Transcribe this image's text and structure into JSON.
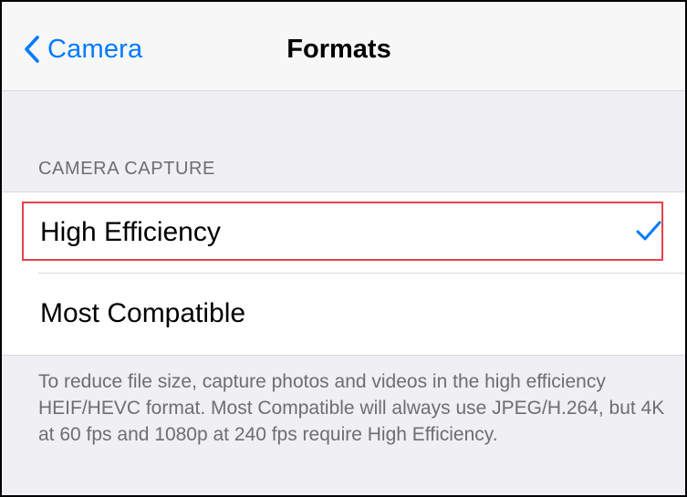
{
  "navbar": {
    "back_label": "Camera",
    "title": "Formats",
    "back_icon": "chevron-left-icon"
  },
  "section": {
    "header": "CAMERA CAPTURE",
    "options": [
      {
        "label": "High Efficiency",
        "selected": true
      },
      {
        "label": "Most Compatible",
        "selected": false
      }
    ],
    "selected_icon": "checkmark-icon",
    "footer": "To reduce file size, capture photos and videos in the high efficiency HEIF/HEVC format. Most Compatible will always use JPEG/H.264, but 4K at 60 fps and 1080p at 240 fps require High Efficiency."
  },
  "colors": {
    "accent": "#007aff",
    "background": "#efeff4",
    "separator": "#d8d8dc",
    "secondary_text": "#6d6d72",
    "highlight_border": "#e8424a"
  }
}
